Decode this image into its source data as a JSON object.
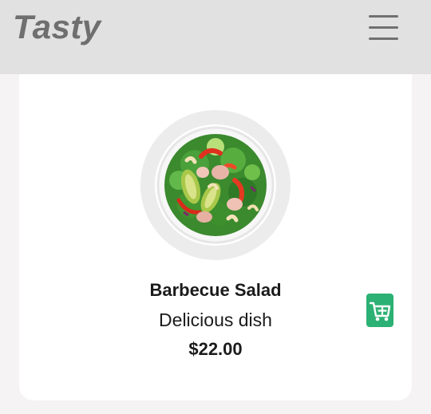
{
  "header": {
    "logo_text": "Tasty",
    "menu_icon": "hamburger-menu-icon"
  },
  "item": {
    "name": "Barbecue Salad",
    "description": "Delicious dish",
    "price": "$22.00",
    "image_icon": "salad-bowl-image"
  },
  "cart": {
    "icon": "add-to-cart-icon"
  },
  "colors": {
    "header_bg": "#e1e1e1",
    "page_bg": "#f5f3f4",
    "card_bg": "#ffffff",
    "logo": "#6f6f6f",
    "accent": "#2bb173",
    "text": "#1b1b1b"
  }
}
